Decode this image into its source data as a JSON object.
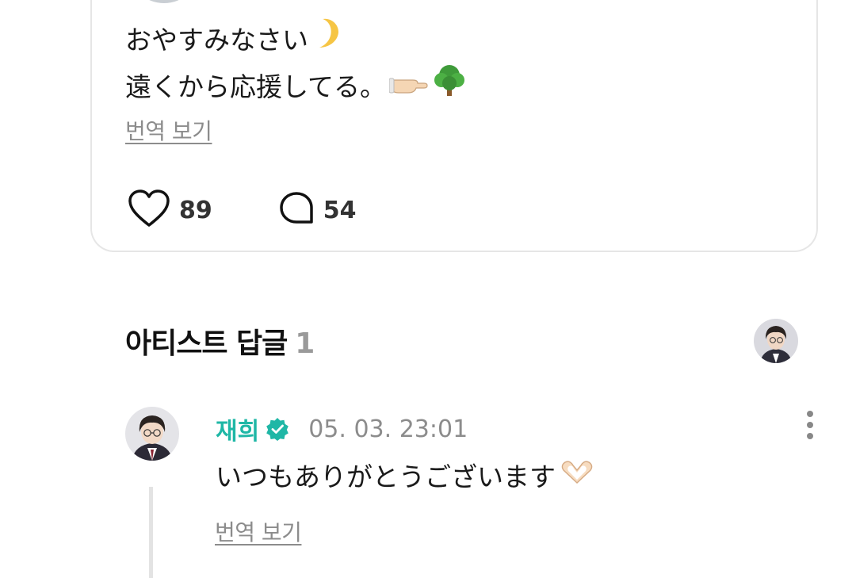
{
  "post": {
    "text_line_1": "おやすみなさい",
    "text_line_1_emoji": "crescent-moon",
    "text_line_2": "遠くから応援してる。",
    "text_line_2_emojis": [
      "pointing-hand",
      "tree"
    ],
    "translate_label": "번역 보기",
    "like_count": "89",
    "comment_count": "54"
  },
  "artist_replies": {
    "title": "아티스트 답글",
    "count": "1",
    "reply": {
      "author": "재희",
      "verified": true,
      "timestamp": "05. 03. 23:01",
      "text": "いつもありがとうございます",
      "text_emoji": "heart-hands",
      "translate_label": "번역 보기"
    }
  },
  "colors": {
    "accent_name": "#1fb7a6",
    "muted_text": "#8c8c8c",
    "card_border": "#e6e6e6"
  },
  "icons": [
    "heart-outline-icon",
    "comment-bubble-icon",
    "verified-badge-icon",
    "more-vertical-icon"
  ]
}
